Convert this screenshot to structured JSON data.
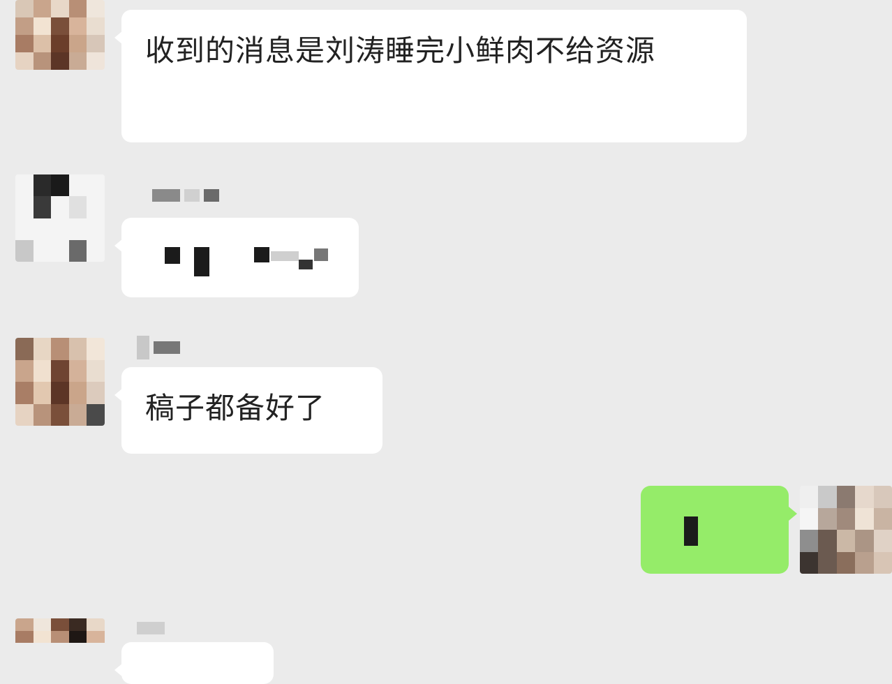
{
  "messages": [
    {
      "sender": "other",
      "text": "收到的消息是刘涛睡完小鲜肉不给资源"
    },
    {
      "sender": "other",
      "text": ""
    },
    {
      "sender": "other",
      "text": "稿子都备好了"
    },
    {
      "sender": "self",
      "text": ""
    },
    {
      "sender": "other",
      "text": ""
    }
  ],
  "colors": {
    "background": "#ebebeb",
    "incoming_bubble": "#ffffff",
    "outgoing_bubble": "#95ec69"
  },
  "icons": [
    "avatar-pixelated"
  ]
}
